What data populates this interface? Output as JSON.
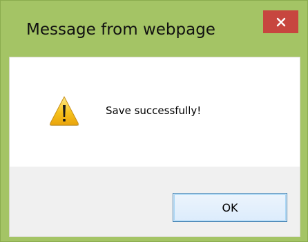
{
  "dialog": {
    "title": "Message from webpage",
    "message": "Save successfully!",
    "ok_label": "OK",
    "icons": {
      "close": "close-icon",
      "warning": "warning-icon"
    },
    "colors": {
      "frame": "#a4c465",
      "close_button": "#c7463f",
      "content_background": "#ffffff",
      "footer_background": "#f0f0f0",
      "button_border": "#3c7fb1"
    }
  }
}
